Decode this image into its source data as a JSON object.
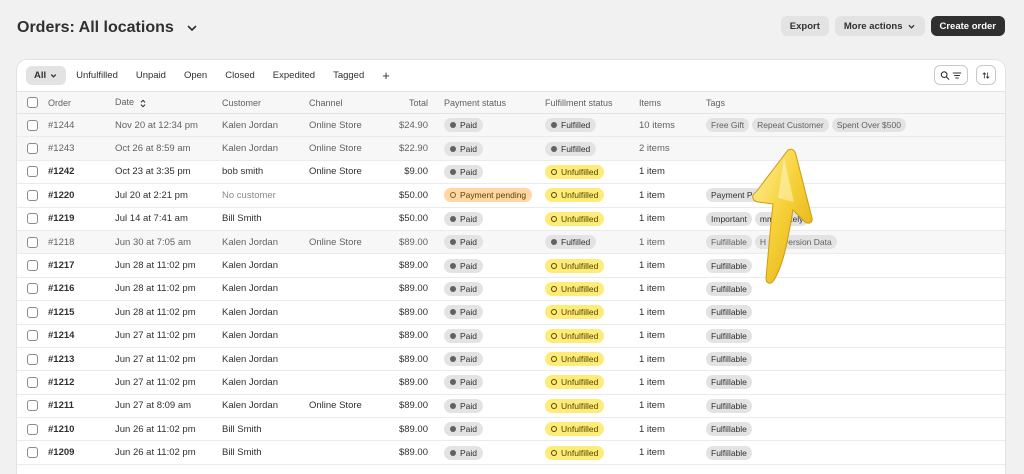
{
  "header": {
    "title": "Orders:  All locations",
    "export_label": "Export",
    "more_actions_label": "More actions",
    "create_order_label": "Create order"
  },
  "tabs": [
    "All",
    "Unfulfilled",
    "Unpaid",
    "Open",
    "Closed",
    "Expedited",
    "Tagged"
  ],
  "add_tab_label": "+",
  "columns": {
    "order": "Order",
    "date": "Date",
    "customer": "Customer",
    "channel": "Channel",
    "total": "Total",
    "payment": "Payment status",
    "fulfillment": "Fulfillment status",
    "items": "Items",
    "tags": "Tags"
  },
  "orders": [
    {
      "order": "#1244",
      "date": "Nov 20 at 12:34 pm",
      "customer": "Kalen Jordan",
      "channel": "Online Store",
      "total": "$24.90",
      "payment": "Paid",
      "payment_style": "gray",
      "fulfillment": "Fulfilled",
      "fulfillment_style": "gray",
      "items": "10 items",
      "tags": [
        "Free Gift",
        "Repeat Customer",
        "Spent Over $500"
      ],
      "muted": true
    },
    {
      "order": "#1243",
      "date": "Oct 26 at 8:59 am",
      "customer": "Kalen Jordan",
      "channel": "Online Store",
      "total": "$22.90",
      "payment": "Paid",
      "payment_style": "gray",
      "fulfillment": "Fulfilled",
      "fulfillment_style": "gray",
      "items": "2 items",
      "tags": [],
      "muted": true
    },
    {
      "order": "#1242",
      "date": "Oct 23 at 3:35 pm",
      "customer": "bob smith",
      "channel": "Online Store",
      "total": "$9.00",
      "payment": "Paid",
      "payment_style": "gray",
      "fulfillment": "Unfulfilled",
      "fulfillment_style": "yellow",
      "items": "1 item",
      "tags": [],
      "muted": false
    },
    {
      "order": "#1220",
      "date": "Jul 20 at 2:21 pm",
      "customer": "No customer",
      "channel": "",
      "total": "$50.00",
      "payment": "Payment pending",
      "payment_style": "orange",
      "fulfillment": "Unfulfilled",
      "fulfillment_style": "yellow",
      "items": "1 item",
      "tags": [
        "Payment Pen"
      ],
      "muted": false,
      "no_customer": true
    },
    {
      "order": "#1219",
      "date": "Jul 14 at 7:41 am",
      "customer": "Bill Smith",
      "channel": "",
      "total": "$50.00",
      "payment": "Paid",
      "payment_style": "gray",
      "fulfillment": "Unfulfilled",
      "fulfillment_style": "yellow",
      "items": "1 item",
      "tags": [
        "Important",
        "mmediately"
      ],
      "muted": false
    },
    {
      "order": "#1218",
      "date": "Jun 30 at 7:05 am",
      "customer": "Kalen Jordan",
      "channel": "Online Store",
      "total": "$89.00",
      "payment": "Paid",
      "payment_style": "gray",
      "fulfillment": "Fulfilled",
      "fulfillment_style": "gray",
      "items": "1 item",
      "tags": [
        "Fulfillable",
        "H  Conversion Data"
      ],
      "muted": true
    },
    {
      "order": "#1217",
      "date": "Jun 28 at 11:02 pm",
      "customer": "Kalen Jordan",
      "channel": "",
      "total": "$89.00",
      "payment": "Paid",
      "payment_style": "gray",
      "fulfillment": "Unfulfilled",
      "fulfillment_style": "yellow",
      "items": "1 item",
      "tags": [
        "Fulfillable"
      ],
      "muted": false
    },
    {
      "order": "#1216",
      "date": "Jun 28 at 11:02 pm",
      "customer": "Kalen Jordan",
      "channel": "",
      "total": "$89.00",
      "payment": "Paid",
      "payment_style": "gray",
      "fulfillment": "Unfulfilled",
      "fulfillment_style": "yellow",
      "items": "1 item",
      "tags": [
        "Fulfillable"
      ],
      "muted": false
    },
    {
      "order": "#1215",
      "date": "Jun 28 at 11:02 pm",
      "customer": "Kalen Jordan",
      "channel": "",
      "total": "$89.00",
      "payment": "Paid",
      "payment_style": "gray",
      "fulfillment": "Unfulfilled",
      "fulfillment_style": "yellow",
      "items": "1 item",
      "tags": [
        "Fulfillable"
      ],
      "muted": false
    },
    {
      "order": "#1214",
      "date": "Jun 27 at 11:02 pm",
      "customer": "Kalen Jordan",
      "channel": "",
      "total": "$89.00",
      "payment": "Paid",
      "payment_style": "gray",
      "fulfillment": "Unfulfilled",
      "fulfillment_style": "yellow",
      "items": "1 item",
      "tags": [
        "Fulfillable"
      ],
      "muted": false
    },
    {
      "order": "#1213",
      "date": "Jun 27 at 11:02 pm",
      "customer": "Kalen Jordan",
      "channel": "",
      "total": "$89.00",
      "payment": "Paid",
      "payment_style": "gray",
      "fulfillment": "Unfulfilled",
      "fulfillment_style": "yellow",
      "items": "1 item",
      "tags": [
        "Fulfillable"
      ],
      "muted": false
    },
    {
      "order": "#1212",
      "date": "Jun 27 at 11:02 pm",
      "customer": "Kalen Jordan",
      "channel": "",
      "total": "$89.00",
      "payment": "Paid",
      "payment_style": "gray",
      "fulfillment": "Unfulfilled",
      "fulfillment_style": "yellow",
      "items": "1 item",
      "tags": [
        "Fulfillable"
      ],
      "muted": false
    },
    {
      "order": "#1211",
      "date": "Jun 27 at 8:09 am",
      "customer": "Kalen Jordan",
      "channel": "Online Store",
      "total": "$89.00",
      "payment": "Paid",
      "payment_style": "gray",
      "fulfillment": "Unfulfilled",
      "fulfillment_style": "yellow",
      "items": "1 item",
      "tags": [
        "Fulfillable"
      ],
      "muted": false
    },
    {
      "order": "#1210",
      "date": "Jun 26 at 11:02 pm",
      "customer": "Bill Smith",
      "channel": "",
      "total": "$89.00",
      "payment": "Paid",
      "payment_style": "gray",
      "fulfillment": "Unfulfilled",
      "fulfillment_style": "yellow",
      "items": "1 item",
      "tags": [
        "Fulfillable"
      ],
      "muted": false
    },
    {
      "order": "#1209",
      "date": "Jun 26 at 11:02 pm",
      "customer": "Bill Smith",
      "channel": "",
      "total": "$89.00",
      "payment": "Paid",
      "payment_style": "gray",
      "fulfillment": "Unfulfilled",
      "fulfillment_style": "yellow",
      "items": "1 item",
      "tags": [
        "Fulfillable"
      ],
      "muted": false
    }
  ],
  "icons": {
    "title_dropdown": "chevron-down-icon",
    "search_filter": "search-filter-icon",
    "sort": "sort-icon",
    "date_sort": "sort-arrows-icon",
    "cursor": "arrow-pointer-icon"
  },
  "colors": {
    "unfulfilled_badge": "#ffeb78",
    "payment_pending_badge": "#ffd6a4",
    "neutral_badge": "#e3e3e3",
    "primary_button": "#303030",
    "cursor": "#f5c518"
  }
}
